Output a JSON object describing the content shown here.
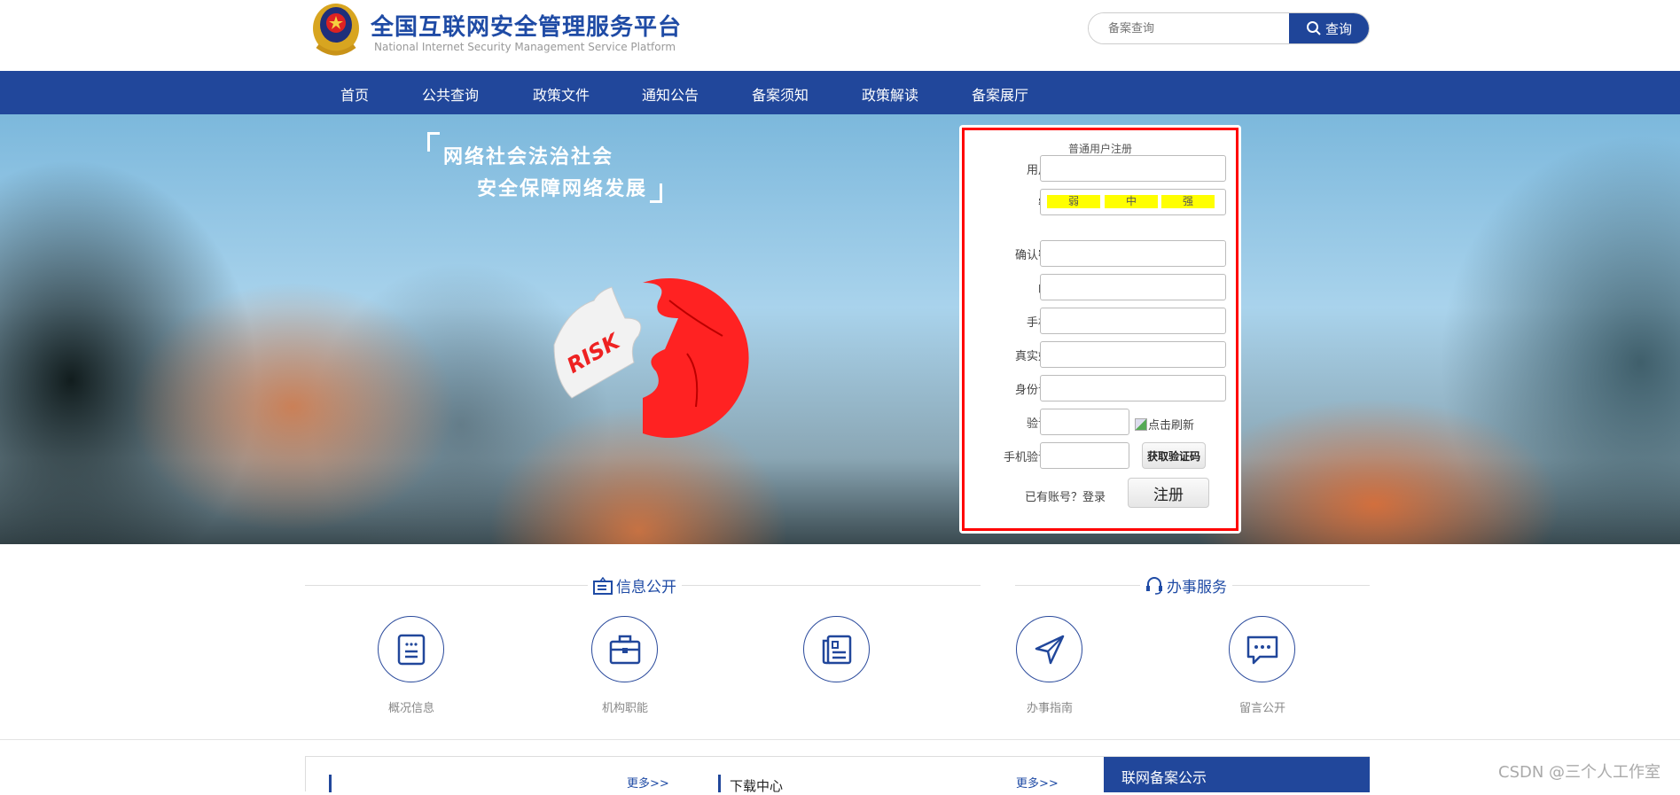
{
  "header": {
    "title": "全国互联网安全管理服务平台",
    "subtitle": "National Internet Security Management Service Platform",
    "search_placeholder": "备案查询",
    "search_button": "查询"
  },
  "nav": [
    "首页",
    "公共查询",
    "政策文件",
    "通知公告",
    "备案须知",
    "政策解读",
    "备案展厅"
  ],
  "hero": {
    "slogan_line1": "网络社会法治社会",
    "slogan_line2": "安全保障网络发展",
    "puzzle_text": "RISK"
  },
  "form": {
    "title": "普通用户注册",
    "labels": {
      "username": "用户名",
      "password": "密码",
      "confirm": "确认密码",
      "email": "邮箱",
      "phone": "手机号",
      "realname": "真实姓名",
      "idcard": "身份证号",
      "captcha": "验证码",
      "sms": "手机验证码"
    },
    "strength": [
      "弱",
      "中",
      "强"
    ],
    "captcha_alt": "点击刷新",
    "get_code": "获取验证码",
    "has_account": "已有账号？登录",
    "register": "注册"
  },
  "sections": {
    "info_title": "信息公开",
    "service_title": "办事服务",
    "items": [
      {
        "label": "概况信息",
        "icon": "document-list-icon"
      },
      {
        "label": "机构职能",
        "icon": "briefcase-icon"
      },
      {
        "label": "",
        "icon": "newspaper-icon"
      },
      {
        "label": "办事指南",
        "icon": "navigation-arrow-icon"
      },
      {
        "label": "留言公开",
        "icon": "chat-bubble-icon"
      }
    ]
  },
  "bottom": {
    "more1": "更多>>",
    "download": "下载中心",
    "more2": "更多>>",
    "panel_title": "联网备案公示"
  },
  "watermark": "CSDN @三个人工作室",
  "colors": {
    "brand": "#21479b",
    "form_border": "#ff0000",
    "strength": "#ffff00"
  }
}
